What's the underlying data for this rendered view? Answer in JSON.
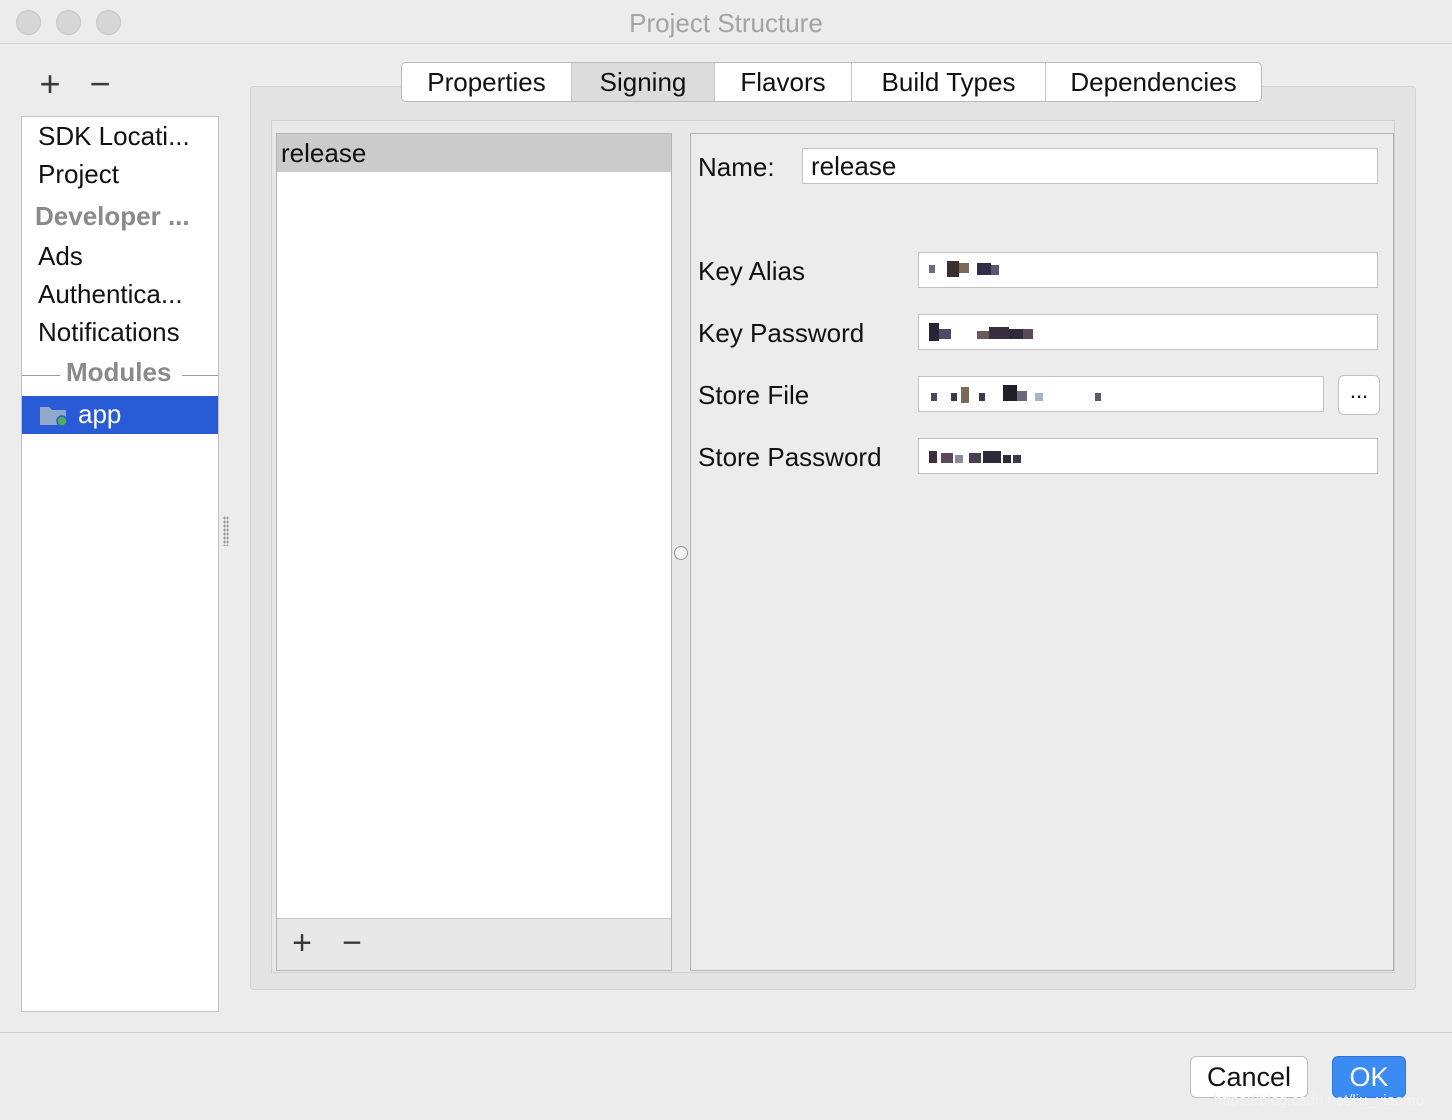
{
  "window": {
    "title": "Project Structure"
  },
  "sidebar": {
    "add_label": "+",
    "remove_label": "−",
    "items": [
      {
        "label": "SDK Locati..."
      },
      {
        "label": "Project"
      },
      {
        "label": "Developer ..."
      },
      {
        "label": "Ads"
      },
      {
        "label": "Authentica..."
      },
      {
        "label": "Notifications"
      }
    ],
    "modules_heading": "Modules",
    "selected_module": "app"
  },
  "tabs": [
    {
      "label": "Properties"
    },
    {
      "label": "Signing"
    },
    {
      "label": "Flavors"
    },
    {
      "label": "Build Types"
    },
    {
      "label": "Dependencies"
    }
  ],
  "active_tab": "Signing",
  "signing_configs": {
    "items": [
      {
        "label": "release"
      }
    ],
    "add_label": "+",
    "remove_label": "−"
  },
  "form": {
    "name_label": "Name:",
    "name_value": "release",
    "key_alias_label": "Key Alias",
    "key_password_label": "Key Password",
    "store_file_label": "Store File",
    "store_password_label": "Store Password",
    "browse_label": "..."
  },
  "buttons": {
    "cancel": "Cancel",
    "ok": "OK"
  },
  "watermark": "https://blog.csdn.net/liu_xiaomo",
  "colors": {
    "selection": "#2a5bd7",
    "ok_button": "#3a8cf2"
  }
}
